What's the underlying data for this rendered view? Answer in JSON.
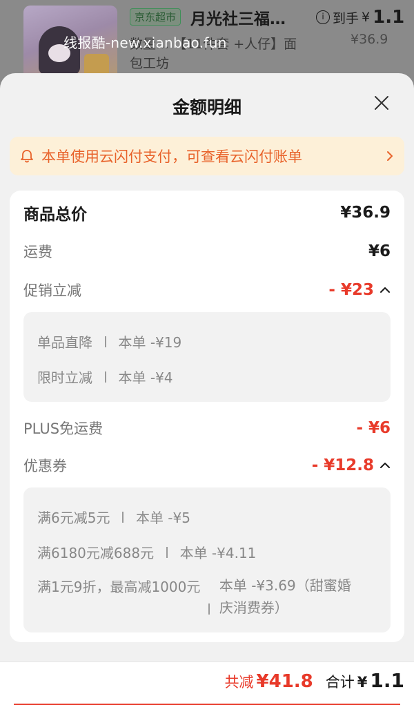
{
  "product": {
    "store_tag": "京东超市",
    "title": "月光社三福…",
    "subtitle": "数量… 【11件套 +人仔】面包工坊",
    "final_label": "到手",
    "final_currency": "¥",
    "final_price": "1.1",
    "original_price": "¥36.9"
  },
  "watermark": "线报酷-new.xianbao.fun",
  "sheet": {
    "title": "金额明细",
    "notice": "本单使用云闪付支付，可查看云闪付账单"
  },
  "breakdown": {
    "total": {
      "label": "商品总价",
      "value": "¥36.9"
    },
    "shipping": {
      "label": "运费",
      "value": "¥6"
    },
    "promo": {
      "label": "促销立减",
      "value": "- ¥23",
      "items": [
        {
          "name": "单品直降",
          "amount": "本单 -¥19"
        },
        {
          "name": "限时立减",
          "amount": "本单 -¥4"
        }
      ]
    },
    "plus": {
      "label": "PLUS免运费",
      "value": "- ¥6"
    },
    "coupon": {
      "label": "优惠券",
      "value": "- ¥12.8",
      "items": [
        {
          "name": "满6元减5元",
          "amount": "本单 -¥5"
        },
        {
          "name": "满6180元减688元",
          "amount": "本单 -¥4.11"
        },
        {
          "name": "满1元9折，最高减1000元",
          "amount": "本单 -¥3.69（甜蜜婚庆消费券）"
        }
      ]
    }
  },
  "footer": {
    "saved_label": "共减",
    "saved_value": "¥41.8",
    "sum_label": "合计",
    "sum_currency": "¥",
    "sum_value": "1.1"
  },
  "colors": {
    "accent_red": "#e83a2a",
    "notice_orange": "#e8622a",
    "notice_bg": "#fdf0d8"
  }
}
